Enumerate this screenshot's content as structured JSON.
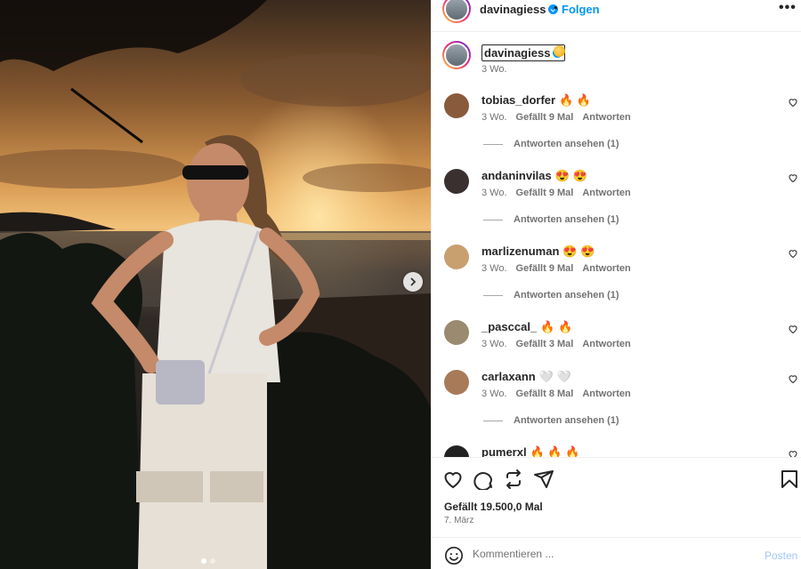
{
  "post": {
    "author": "davinagiess",
    "follow_label": "Folgen",
    "header_dot": "•",
    "more_label": "•••",
    "caption_time": "3 Wo.",
    "likes_text": "Gefällt 19.500,0 Mal",
    "date": "7. März",
    "image_count": 2,
    "active_image": 1
  },
  "comments": [
    {
      "user": "tobias_dorfer",
      "emoji": "🔥 🔥",
      "time": "3 Wo.",
      "likes": "Gefällt 9 Mal",
      "reply": "Antworten",
      "view_replies": "Antworten ansehen (1)"
    },
    {
      "user": "andaninvilas",
      "emoji": "😍 😍",
      "time": "3 Wo.",
      "likes": "Gefällt 9 Mal",
      "reply": "Antworten",
      "view_replies": "Antworten ansehen (1)"
    },
    {
      "user": "marlizenuman",
      "emoji": "😍 😍",
      "time": "3 Wo.",
      "likes": "Gefällt 9 Mal",
      "reply": "Antworten",
      "view_replies": "Antworten ansehen (1)"
    },
    {
      "user": "_pasccal_",
      "emoji": "🔥 🔥",
      "time": "3 Wo.",
      "likes": "Gefällt 3 Mal",
      "reply": "Antworten",
      "view_replies": ""
    },
    {
      "user": "carlaxann",
      "emoji": "🤍 🤍",
      "time": "3 Wo.",
      "likes": "Gefällt 8 Mal",
      "reply": "Antworten",
      "view_replies": "Antworten ansehen (1)"
    },
    {
      "user": "pumerxl",
      "emoji": "🔥 🔥 🔥",
      "time": "",
      "likes": "",
      "reply": "",
      "view_replies": ""
    }
  ],
  "composer": {
    "placeholder": "Kommentieren ...",
    "post_label": "Posten"
  },
  "icons": [
    "verified-badge-icon",
    "more-options-icon",
    "next-image-icon",
    "heart-icon",
    "comment-icon",
    "share-icon",
    "send-icon",
    "bookmark-icon",
    "emoji-icon"
  ],
  "colors": {
    "accent": "#0095f6",
    "text": "#262626",
    "muted": "#737373",
    "post_disabled": "#9ec9f5"
  }
}
